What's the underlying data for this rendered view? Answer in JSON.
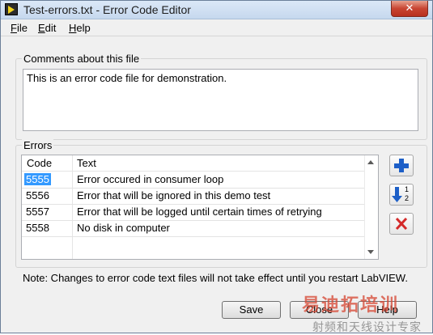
{
  "window": {
    "title": "Test-errors.txt - Error Code Editor",
    "close_glyph": "✕"
  },
  "menu": {
    "file": {
      "mnemonic": "F",
      "rest": "ile"
    },
    "edit": {
      "mnemonic": "E",
      "rest": "dit"
    },
    "help": {
      "mnemonic": "H",
      "rest": "elp"
    }
  },
  "comments": {
    "label": "Comments about this file",
    "value": "This is an error code file for demonstration."
  },
  "errors": {
    "label": "Errors",
    "columns": [
      "Code",
      "Text"
    ],
    "rows": [
      {
        "code": "5555",
        "text": "Error occured in consumer loop",
        "selected": true
      },
      {
        "code": "5556",
        "text": "Error that will be ignored in this demo test",
        "selected": false
      },
      {
        "code": "5557",
        "text": "Error that will be logged until certain times of retrying",
        "selected": false
      },
      {
        "code": "5558",
        "text": "No disk in computer",
        "selected": false
      }
    ]
  },
  "side_buttons": {
    "add_icon": "plus-icon",
    "sort_icon": "sort-ascending-icon",
    "sort_digits": [
      "1",
      "2"
    ],
    "delete_icon": "delete-x-icon"
  },
  "note": "Note: Changes to error code text files will not take effect until you restart LabVIEW.",
  "buttons": {
    "save": "Save",
    "close": "Close",
    "help": "Help"
  },
  "watermark": {
    "brand": "易迪拓培训",
    "subtitle": "射频和天线设计专家"
  },
  "colors": {
    "selection": "#3399ff",
    "add_blue": "#1d5fc7",
    "delete_red": "#d42a2a"
  }
}
